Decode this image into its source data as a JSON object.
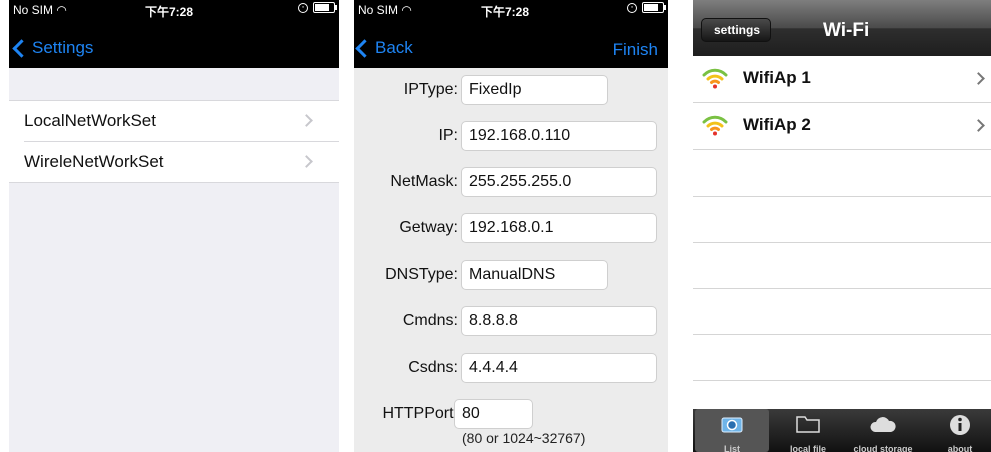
{
  "panel1": {
    "status": {
      "carrier": "No SIM",
      "time": "下午7:28"
    },
    "back_label": "Settings",
    "items": [
      {
        "label": "LocalNetWorkSet"
      },
      {
        "label": "WireleNetWorkSet"
      }
    ]
  },
  "panel2": {
    "status": {
      "carrier": "No SIM",
      "time": "下午7:28"
    },
    "back_label": "Back",
    "finish_label": "Finish",
    "fields": {
      "iptype": {
        "label": "IPType:",
        "value": "FixedIp"
      },
      "ip": {
        "label": "IP:",
        "value": "192.168.0.110"
      },
      "netmask": {
        "label": "NetMask:",
        "value": "255.255.255.0"
      },
      "getway": {
        "label": "Getway:",
        "value": "192.168.0.1"
      },
      "dnstype": {
        "label": "DNSType:",
        "value": "ManualDNS"
      },
      "cmdns": {
        "label": "Cmdns:",
        "value": "8.8.8.8"
      },
      "csdns": {
        "label": "Csdns:",
        "value": "4.4.4.4"
      },
      "httpport": {
        "label": "HTTPPort:",
        "value": "80"
      }
    },
    "port_hint": "(80 or 1024~32767)"
  },
  "panel3": {
    "back_label": "settings",
    "title": "Wi-Fi",
    "networks": [
      {
        "name": "WifiAp 1"
      },
      {
        "name": "WifiAp 2"
      }
    ],
    "tabs": [
      {
        "label": "List",
        "icon": "camera-icon"
      },
      {
        "label": "local file",
        "icon": "folder-icon"
      },
      {
        "label": "cloud storage",
        "icon": "cloud-icon"
      },
      {
        "label": "about",
        "icon": "info-icon"
      }
    ]
  },
  "colors": {
    "ios_blue": "#1e84f3",
    "nav_black": "#000000",
    "group_bg": "#efeff4"
  }
}
